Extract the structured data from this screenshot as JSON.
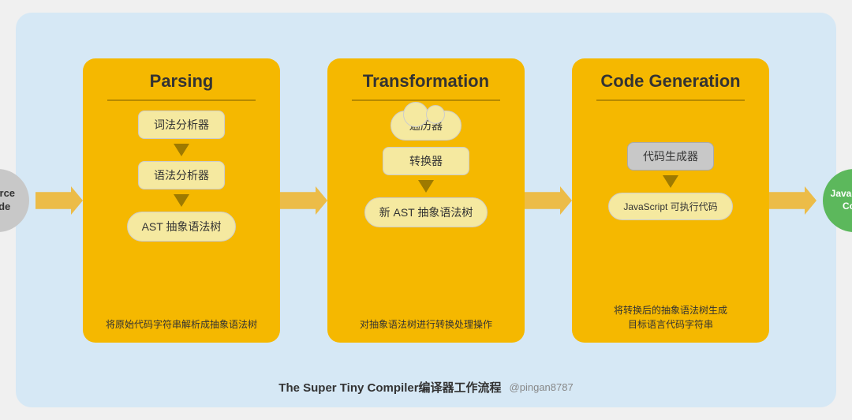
{
  "background_color": "#d6e8f5",
  "source_code": {
    "label": "Source\nCode"
  },
  "js_code": {
    "label": "JavaScript\nCode"
  },
  "phases": [
    {
      "id": "parsing",
      "title": "Parsing",
      "items": [
        {
          "type": "box",
          "text": "词法分析器"
        },
        {
          "type": "down-arrow"
        },
        {
          "type": "box",
          "text": "语法分析器"
        },
        {
          "type": "down-arrow"
        },
        {
          "type": "oval",
          "text": "AST 抽象语法树"
        }
      ],
      "description": "将原始代码字符串解析成抽象语法树"
    },
    {
      "id": "transformation",
      "title": "Transformation",
      "items": [
        {
          "type": "cloud",
          "text": "遍历器"
        },
        {
          "type": "box",
          "text": "转换器"
        },
        {
          "type": "down-arrow"
        },
        {
          "type": "oval",
          "text": "新 AST 抽象语法树"
        }
      ],
      "description": "对抽象语法树进行转换处理操作"
    },
    {
      "id": "code-generation",
      "title": "Code Generation",
      "items": [
        {
          "type": "box-gray",
          "text": "代码生成器"
        },
        {
          "type": "down-arrow"
        },
        {
          "type": "oval",
          "text": "JavaScript 可执行代码"
        }
      ],
      "description": "将转换后的抽象语法树生成\n目标语言代码字符串"
    }
  ],
  "footer": {
    "main_text": "The Super Tiny Compiler编译器工作流程",
    "handle": "@pingan8787"
  }
}
